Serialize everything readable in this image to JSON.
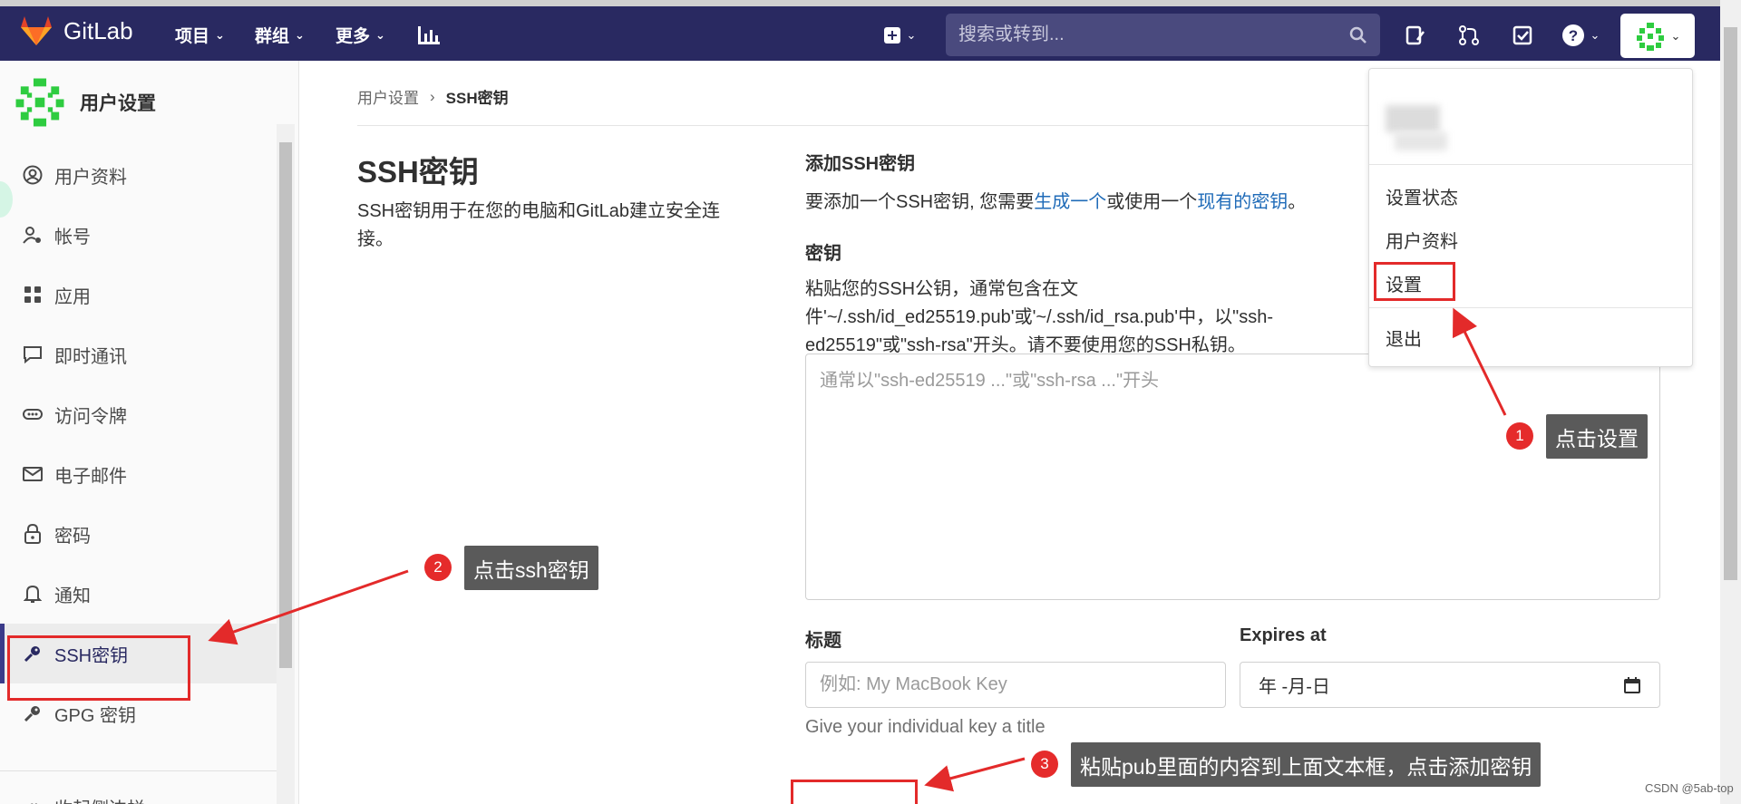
{
  "app": {
    "name": "GitLab"
  },
  "nav": {
    "projects": "项目",
    "groups": "群组",
    "more": "更多"
  },
  "search": {
    "placeholder": "搜索或转到..."
  },
  "sidebar": {
    "title": "用户设置",
    "items": [
      {
        "label": "用户资料"
      },
      {
        "label": "帐号"
      },
      {
        "label": "应用"
      },
      {
        "label": "即时通讯"
      },
      {
        "label": "访问令牌"
      },
      {
        "label": "电子邮件"
      },
      {
        "label": "密码"
      },
      {
        "label": "通知"
      },
      {
        "label": "SSH密钥"
      },
      {
        "label": "GPG 密钥"
      },
      {
        "label": "收起侧边栏"
      }
    ]
  },
  "breadcrumb": {
    "parent": "用户设置",
    "current": "SSH密钥"
  },
  "ssh": {
    "heading": "SSH密钥",
    "description": "SSH密钥用于在您的电脑和GitLab建立安全连接。",
    "add_title": "添加SSH密钥",
    "add_desc_pre": "要添加一个SSH密钥, 您需要",
    "add_desc_link1": "生成一个",
    "add_desc_mid": "或使用一个",
    "add_desc_link2": "现有的密钥",
    "add_desc_post": "。",
    "key_label": "密钥",
    "key_help": "粘贴您的SSH公钥，通常包含在文件'~/.ssh/id_ed25519.pub'或'~/.ssh/id_rsa.pub'中，以\"ssh-ed25519\"或\"ssh-rsa\"开头。请不要使用您的SSH私钥。",
    "key_placeholder": "通常以\"ssh-ed25519 ...\"或\"ssh-rsa ...\"开头",
    "title_label": "标题",
    "title_placeholder": "例如: My MacBook Key",
    "title_hint": "Give your individual key a title",
    "expires_label": "Expires at",
    "expires_value": "年 -月-日"
  },
  "dropdown": {
    "items": [
      "设置状态",
      "用户资料",
      "设置",
      "退出"
    ]
  },
  "annotations": [
    {
      "num": "1",
      "text": "点击设置"
    },
    {
      "num": "2",
      "text": "点击ssh密钥"
    },
    {
      "num": "3",
      "text": "粘贴pub里面的内容到上面文本框，点击添加密钥"
    }
  ],
  "watermark": "CSDN @5ab-top",
  "colors": {
    "nav_bg": "#292961",
    "highlight": "#e32a2a",
    "link": "#1f6bb8"
  }
}
